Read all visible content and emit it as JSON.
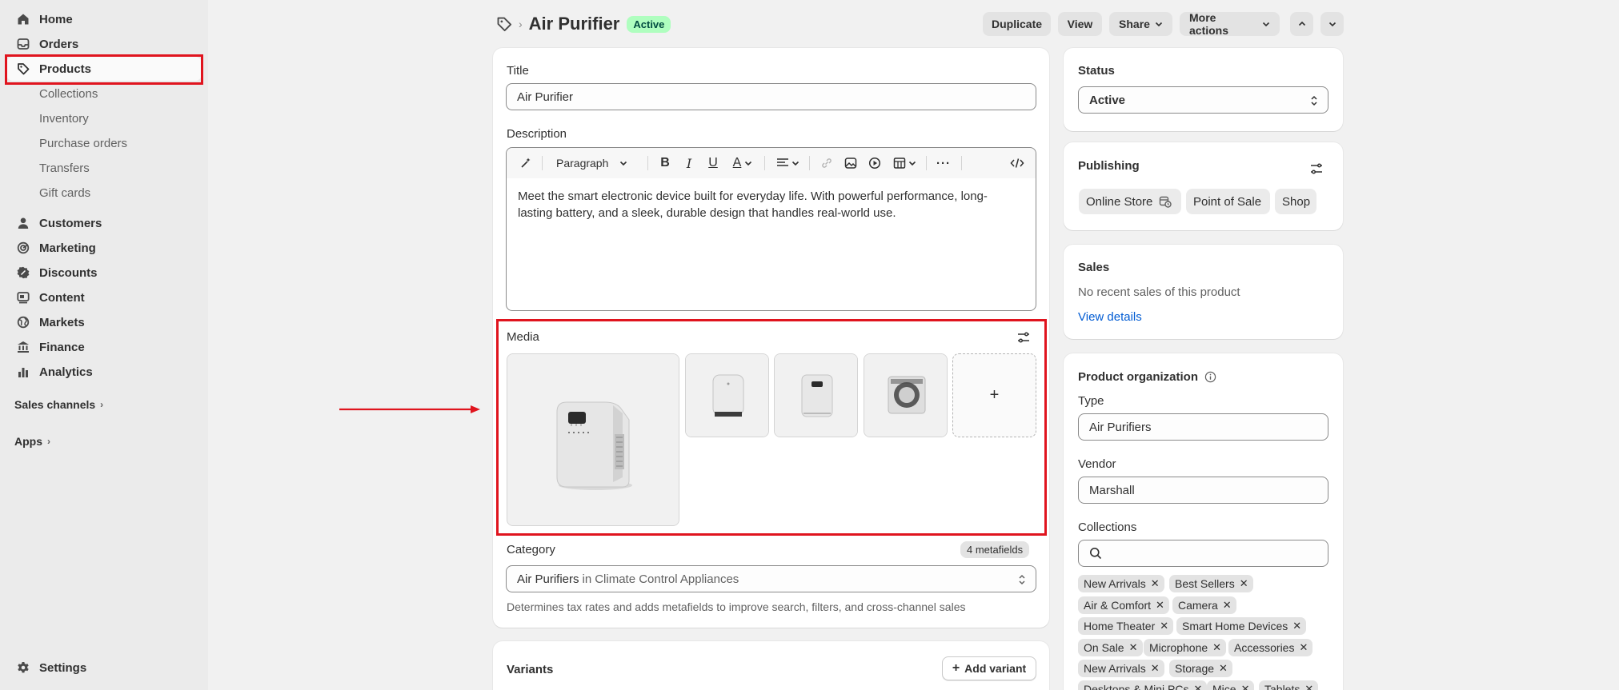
{
  "sidebar": {
    "items": [
      {
        "label": "Home",
        "icon": "home-icon"
      },
      {
        "label": "Orders",
        "icon": "inbox-icon"
      },
      {
        "label": "Products",
        "icon": "tag-icon"
      },
      {
        "label": "Customers",
        "icon": "person-icon"
      },
      {
        "label": "Marketing",
        "icon": "target-icon"
      },
      {
        "label": "Discounts",
        "icon": "discount-icon"
      },
      {
        "label": "Content",
        "icon": "content-icon"
      },
      {
        "label": "Markets",
        "icon": "globe-icon"
      },
      {
        "label": "Finance",
        "icon": "bank-icon"
      },
      {
        "label": "Analytics",
        "icon": "chart-icon"
      }
    ],
    "product_subitems": [
      "Collections",
      "Inventory",
      "Purchase orders",
      "Transfers",
      "Gift cards"
    ],
    "sales_channels": "Sales channels",
    "apps": "Apps",
    "settings": "Settings"
  },
  "header": {
    "title": "Air Purifier",
    "status_badge": "Active",
    "buttons": {
      "duplicate": "Duplicate",
      "view": "View",
      "share": "Share",
      "more_actions": "More actions"
    }
  },
  "product": {
    "title_label": "Title",
    "title_value": "Air Purifier",
    "description_label": "Description",
    "toolbar": {
      "paragraph": "Paragraph"
    },
    "description_text": "Meet the smart electronic device built for everyday life. With powerful performance, long-lasting battery, and a sleek, durable design that handles real-world use."
  },
  "media": {
    "label": "Media",
    "add_symbol": "+"
  },
  "category": {
    "label": "Category",
    "metafields": "4 metafields",
    "value_main": "Air Purifiers",
    "value_in": "in",
    "value_parent": "Climate Control Appliances",
    "help": "Determines tax rates and adds metafields to improve search, filters, and cross-channel sales"
  },
  "variants": {
    "label": "Variants",
    "add_button": "Add variant"
  },
  "status_card": {
    "label": "Status",
    "value": "Active"
  },
  "publishing": {
    "label": "Publishing",
    "channels": [
      "Online Store",
      "Point of Sale",
      "Shop"
    ]
  },
  "sales": {
    "label": "Sales",
    "text": "No recent sales of this product",
    "link": "View details"
  },
  "organization": {
    "label": "Product organization",
    "type_label": "Type",
    "type_value": "Air Purifiers",
    "vendor_label": "Vendor",
    "vendor_value": "Marshall",
    "collections_label": "Collections",
    "search_placeholder": "",
    "tags": [
      "New Arrivals",
      "Best Sellers",
      "Air & Comfort",
      "Camera",
      "Home Theater",
      "Smart Home Devices",
      "On Sale",
      "Microphone",
      "Accessories",
      "New Arrivals",
      "Storage",
      "Desktops & Mini PCs",
      "Mice",
      "Tablets"
    ]
  },
  "colors": {
    "highlight": "#e0141e",
    "active_badge_bg": "#affebf",
    "link": "#005bd3"
  }
}
